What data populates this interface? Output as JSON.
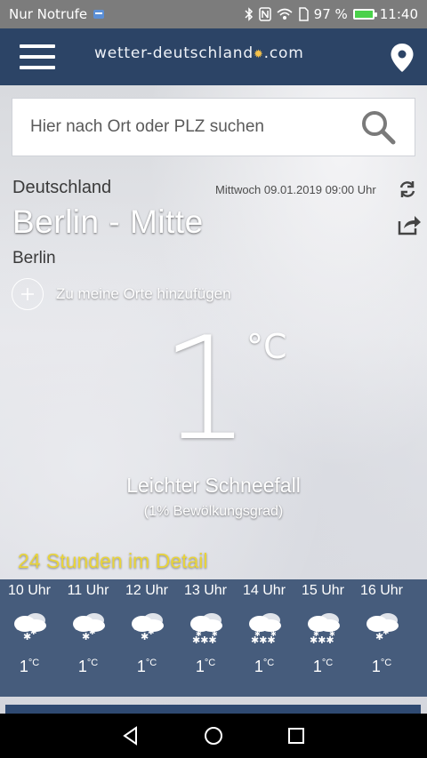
{
  "status_bar": {
    "carrier": "Nur Notrufe",
    "battery": "97 %",
    "time": "11:40"
  },
  "header": {
    "logo_text": "wetter-deutschland",
    "logo_suffix": ".com"
  },
  "search": {
    "placeholder": "Hier nach Ort oder PLZ suchen"
  },
  "location": {
    "country": "Deutschland",
    "date": "Mittwoch 09.01.2019 09:00 Uhr",
    "city": "Berlin - Mitte",
    "region": "Berlin",
    "add_favorite": "Zu meine Orte hinzufügen"
  },
  "current": {
    "temperature": "1",
    "unit": "°C",
    "condition": "Leichter Schneefall",
    "clouds": "(1% Bewölkungsgrad)"
  },
  "detail_title": "24 Stunden im Detail",
  "hourly": [
    {
      "hour": "10 Uhr",
      "temp": "1",
      "unit": "°C",
      "icon": "light-snow-icon"
    },
    {
      "hour": "11 Uhr",
      "temp": "1",
      "unit": "°C",
      "icon": "light-snow-icon"
    },
    {
      "hour": "12 Uhr",
      "temp": "1",
      "unit": "°C",
      "icon": "light-snow-icon"
    },
    {
      "hour": "13 Uhr",
      "temp": "1",
      "unit": "°C",
      "icon": "snow-icon"
    },
    {
      "hour": "14 Uhr",
      "temp": "1",
      "unit": "°C",
      "icon": "snow-icon"
    },
    {
      "hour": "15 Uhr",
      "temp": "1",
      "unit": "°C",
      "icon": "snow-icon"
    },
    {
      "hour": "16 Uhr",
      "temp": "1",
      "unit": "°C",
      "icon": "light-snow-icon"
    }
  ],
  "colors": {
    "header": "#2c4466",
    "hourly_bg": "#465c7c",
    "accent_yellow": "#e9d43a"
  }
}
